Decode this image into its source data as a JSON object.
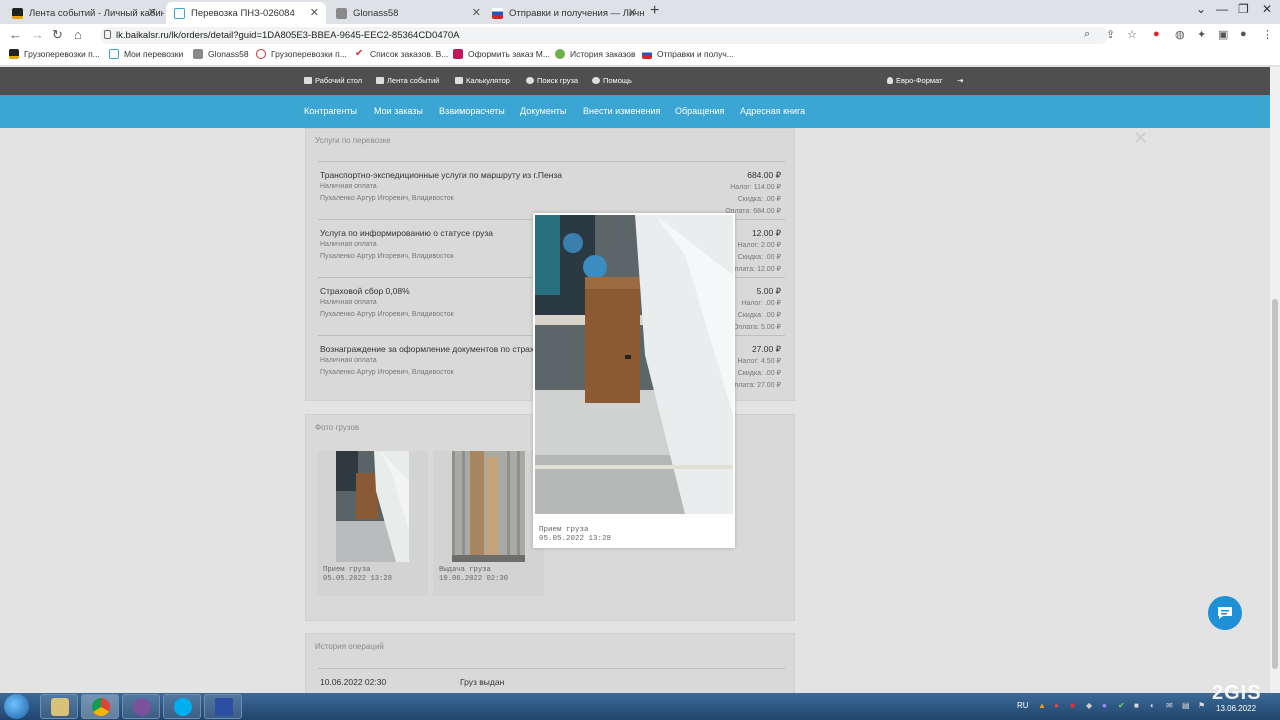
{
  "browser": {
    "tabs": [
      {
        "label": "Лента событий - Личный кабин",
        "icon": "site-logo-icon"
      },
      {
        "label": "Перевозка ПНЗ-026084",
        "icon": "cube-icon"
      },
      {
        "label": "Glonass58",
        "icon": "glonass-icon"
      },
      {
        "label": "Отправки и получения — Личн",
        "icon": "flag-icon"
      }
    ],
    "url": "lk.baikalsr.ru/lk/orders/detail?guid=1DA805E3-BBEA-9645-EEC2-85364CD0470A",
    "bookmarks": [
      "Грузоперевозки п...",
      "Мои перевозки",
      "Glonass58",
      "Грузоперевозки п...",
      "Список заказов. В...",
      "Оформить заказ М...",
      "История заказов",
      "Отправки и получ..."
    ]
  },
  "topnav": {
    "items": [
      "Рабочий стол",
      "Лента событий",
      "Калькулятор",
      "Поиск груза",
      "Помощь"
    ],
    "user": "Евро-Формат"
  },
  "subnav": [
    "Контрагенты",
    "Мои заказы",
    "Взаиморасчеты",
    "Документы",
    "Внести изменения",
    "Обращения",
    "Адресная книга"
  ],
  "services": {
    "title": "Услуги по перевозке",
    "items": [
      {
        "name": "Транспортно-экспедиционные услуги по маршруту из г.Пенза",
        "price": "684.00 ₽",
        "payment": "Наличная оплата",
        "person": "Пухаленко Артур Игоревич, Владивосток",
        "tax_label": "Налог:",
        "tax": "114.00 ₽",
        "discount_label": "Скидка:",
        "discount": ".00 ₽",
        "paid_label": "Оплата:",
        "paid": "684.00 ₽"
      },
      {
        "name": "Услуга по информированию о статусе груза",
        "price": "12.00 ₽",
        "payment": "Наличная оплата",
        "person": "Пухаленко Артур Игоревич, Владивосток",
        "tax_label": "Налог:",
        "tax": "2.00 ₽",
        "discount_label": "Скидка:",
        "discount": ".00 ₽",
        "paid_label": "Оплата:",
        "paid": "12.00 ₽"
      },
      {
        "name": "Страховой сбор 0,08%",
        "price": "5.00 ₽",
        "payment": "Наличная оплата",
        "person": "Пухаленко Артур Игоревич, Владивосток",
        "tax_label": "Налог:",
        "tax": ".00 ₽",
        "discount_label": "Скидка:",
        "discount": ".00 ₽",
        "paid_label": "Оплата:",
        "paid": "5.00 ₽"
      },
      {
        "name": "Вознаграждение за оформление документов по страх",
        "price": "27.00 ₽",
        "payment": "Наличная оплата",
        "person": "Пухаленко Артур Игоревич, Владивосток",
        "tax_label": "Налог:",
        "tax": "4.50 ₽",
        "discount_label": "Скидка:",
        "discount": ".00 ₽",
        "paid_label": "Оплата:",
        "paid": "27.00 ₽"
      }
    ]
  },
  "photos": {
    "title": "Фото грузов",
    "items": [
      {
        "caption": "Прием груза",
        "date": "05.05.2022 13:28"
      },
      {
        "caption": "Выдача груза",
        "date": "10.06.2022 02:30"
      }
    ],
    "popup": {
      "caption": "Прием груза",
      "date": "05.05.2022 13:28"
    }
  },
  "history": {
    "title": "История операций",
    "rows": [
      {
        "date": "10.06.2022 02:30",
        "event": "Груз выдан"
      }
    ]
  },
  "system": {
    "lang": "RU",
    "date": "13.06.2022",
    "watermark": "2GIS"
  },
  "colors": {
    "accent": "#3ba6d4",
    "topnav": "#4f4f4f",
    "chat": "#1f8fd6"
  }
}
